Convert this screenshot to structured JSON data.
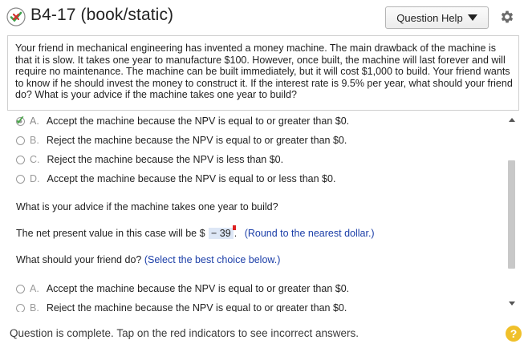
{
  "header": {
    "title": "B4-17 (book/static)",
    "help_label": "Question Help",
    "status_icon": "incorrect-check-icon",
    "settings_icon": "gear-icon"
  },
  "question": {
    "text": "Your friend in mechanical engineering has invented a money machine. The main drawback of the machine is that it is slow. It takes one year to manufacture $100. However, once built, the machine will last forever and will require no maintenance. The machine can be built immediately, but it will cost $1,000 to build. Your friend wants to know if he should invest the money to construct it. If the interest rate is 9.5% per year, what should your friend do? What is your advice if the machine takes one year to build?"
  },
  "part1": {
    "choices": [
      {
        "letter": "A.",
        "text": "Accept the machine because the NPV is equal to or greater than $0.",
        "selected": true
      },
      {
        "letter": "B.",
        "text": "Reject the machine because the NPV is equal to or greater than $0.",
        "selected": false
      },
      {
        "letter": "C.",
        "text": "Reject the machine because the NPV is less than $0.",
        "selected": false
      },
      {
        "letter": "D.",
        "text": "Accept the machine because the NPV is equal to or less than $0.",
        "selected": false
      }
    ]
  },
  "part2": {
    "prompt": "What is your advice if the machine takes one year to build?",
    "npv_prefix": "The net present value in this case will be $",
    "npv_value": "− 39",
    "npv_suffix": ".",
    "npv_hint": "(Round to the nearest dollar.)",
    "friend_prompt": "What should your friend do?",
    "friend_hint": "(Select the best choice below.)",
    "choices": [
      {
        "letter": "A.",
        "text": "Accept the machine because the NPV is equal to or greater than $0."
      },
      {
        "letter": "B.",
        "text": "Reject the machine because the NPV is equal to or greater than $0."
      }
    ]
  },
  "footer": {
    "status": "Question is complete. Tap on the red indicators to see incorrect answers.",
    "help_symbol": "?"
  },
  "colors": {
    "accent_blue": "#1b3ea8",
    "answer_bg": "#dde7f6",
    "correct_green": "#4aa54a",
    "help_yellow": "#f0c02a"
  }
}
